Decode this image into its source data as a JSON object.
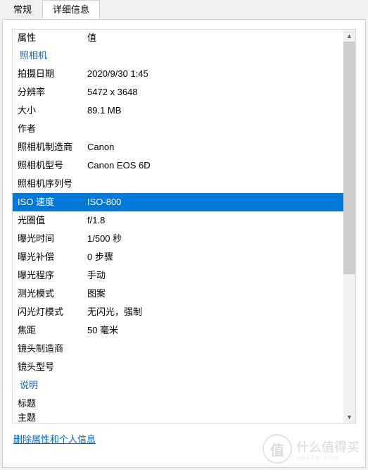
{
  "tabs": {
    "general": "常规",
    "details": "详细信息"
  },
  "headers": {
    "property": "属性",
    "value": "值"
  },
  "sections": {
    "camera": "照相机",
    "description": "说明"
  },
  "rows": {
    "date_taken": {
      "label": "拍摄日期",
      "value": "2020/9/30 1:45"
    },
    "dimensions": {
      "label": "分辨率",
      "value": "5472 x 3648"
    },
    "size": {
      "label": "大小",
      "value": "89.1 MB"
    },
    "author": {
      "label": "作者",
      "value": ""
    },
    "camera_maker": {
      "label": "照相机制造商",
      "value": "Canon"
    },
    "camera_model": {
      "label": "照相机型号",
      "value": "Canon EOS 6D"
    },
    "camera_serial": {
      "label": "照相机序列号",
      "value": ""
    },
    "iso": {
      "label": "ISO 速度",
      "value": "ISO-800"
    },
    "fstop": {
      "label": "光圈值",
      "value": "f/1.8"
    },
    "exposure": {
      "label": "曝光时间",
      "value": "1/500 秒"
    },
    "exp_bias": {
      "label": "曝光补偿",
      "value": "0 步骤"
    },
    "exp_program": {
      "label": "曝光程序",
      "value": "手动"
    },
    "metering": {
      "label": "测光模式",
      "value": "图案"
    },
    "flash": {
      "label": "闪光灯模式",
      "value": "无闪光，强制"
    },
    "focal": {
      "label": "焦距",
      "value": "50 毫米"
    },
    "lens_maker": {
      "label": "镜头制造商",
      "value": ""
    },
    "lens_model": {
      "label": "镜头型号",
      "value": ""
    },
    "title": {
      "label": "标题",
      "value": ""
    },
    "subject": {
      "label": "主题",
      "value": ""
    }
  },
  "link": {
    "remove": "删除属性和个人信息"
  },
  "watermark": {
    "char": "值",
    "text": "什么值得买",
    "sub": "smzdm.com"
  },
  "scroll": {
    "up": "▲",
    "down": "▼"
  }
}
